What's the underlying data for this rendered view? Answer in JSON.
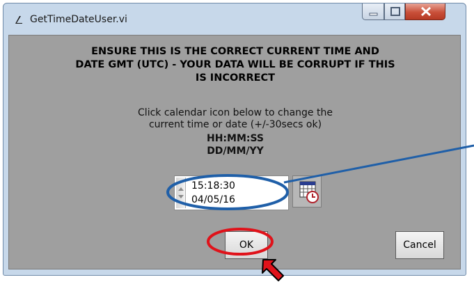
{
  "window": {
    "title": "GetTimeDateUser.vi",
    "icon": "labview-icon",
    "controls": [
      "minimize-icon",
      "maximize-icon",
      "close-icon"
    ]
  },
  "dialog": {
    "warning_lines": [
      "ENSURE THIS IS THE CORRECT CURRENT TIME AND",
      "DATE GMT (UTC) - YOUR DATA WILL BE CORRUPT IF THIS",
      "IS INCORRECT"
    ],
    "instruction_lines": [
      "Click calendar icon below to change the",
      "current time or date (+/-30secs ok)"
    ],
    "format_time": "HH:MM:SS",
    "format_date": "DD/MM/YY",
    "datetime": {
      "time": "15:18:30",
      "date": "04/05/16"
    },
    "calendar_icon": "calendar-clock-icon",
    "ok_label": "OK",
    "cancel_label": "Cancel"
  },
  "annotations": {
    "ellipse_color": "#1f5fa8",
    "circle_color": "#e0121a",
    "arrow_color": "#e0121a",
    "line_color": "#1f5fa8"
  },
  "colors": {
    "panel_bg": "#9f9f9f",
    "frame_bg": "#c7d8ea"
  }
}
